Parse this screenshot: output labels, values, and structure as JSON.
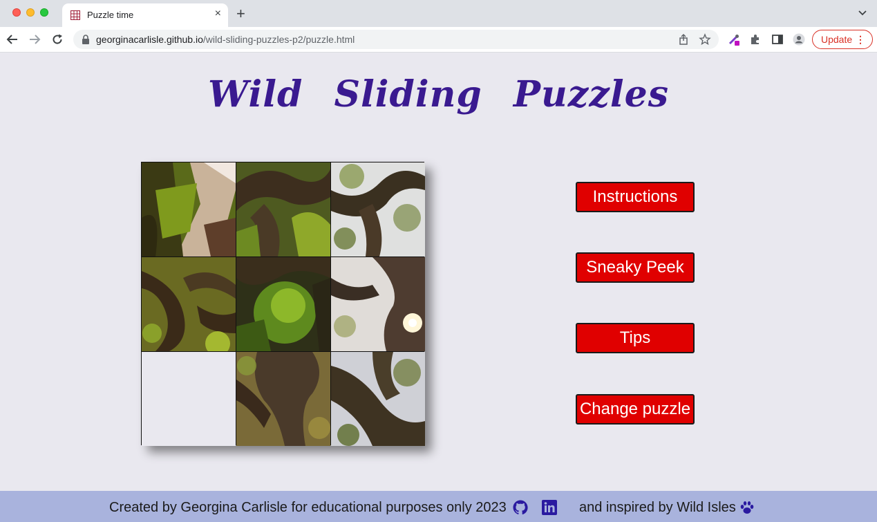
{
  "browser": {
    "tab_title": "Puzzle time",
    "new_tab_label": "+",
    "close_tab_label": "×",
    "url_host": "georginacarlisle.github.io",
    "url_path": "/wild-sliding-puzzles-p2/puzzle.html",
    "update_label": "Update",
    "menu_label": "⋮"
  },
  "page": {
    "title": "Wild Sliding Puzzles",
    "title_color": "#3a1a90"
  },
  "puzzle": {
    "grid": "3x3",
    "empty_slot": 7,
    "tiles": [
      "forest-path",
      "tree-branches-moss",
      "tree-canopy-sky",
      "twisted-branches",
      "green-fern-arch",
      "tree-trunk-sunburst",
      "empty",
      "tree-limb-fork",
      "branches-against-sky"
    ]
  },
  "menu": {
    "instructions": "Instructions",
    "sneaky_peek": "Sneaky Peek",
    "tips": "Tips",
    "change_puzzle": "Change puzzle",
    "button_color": "#e00000"
  },
  "footer": {
    "credit": "Created by Georgina Carlisle for educational purposes only 2023",
    "inspired": "and inspired by Wild Isles",
    "background": "#a9b3dd",
    "icons": [
      "github-icon",
      "linkedin-icon",
      "paw-icon"
    ]
  }
}
